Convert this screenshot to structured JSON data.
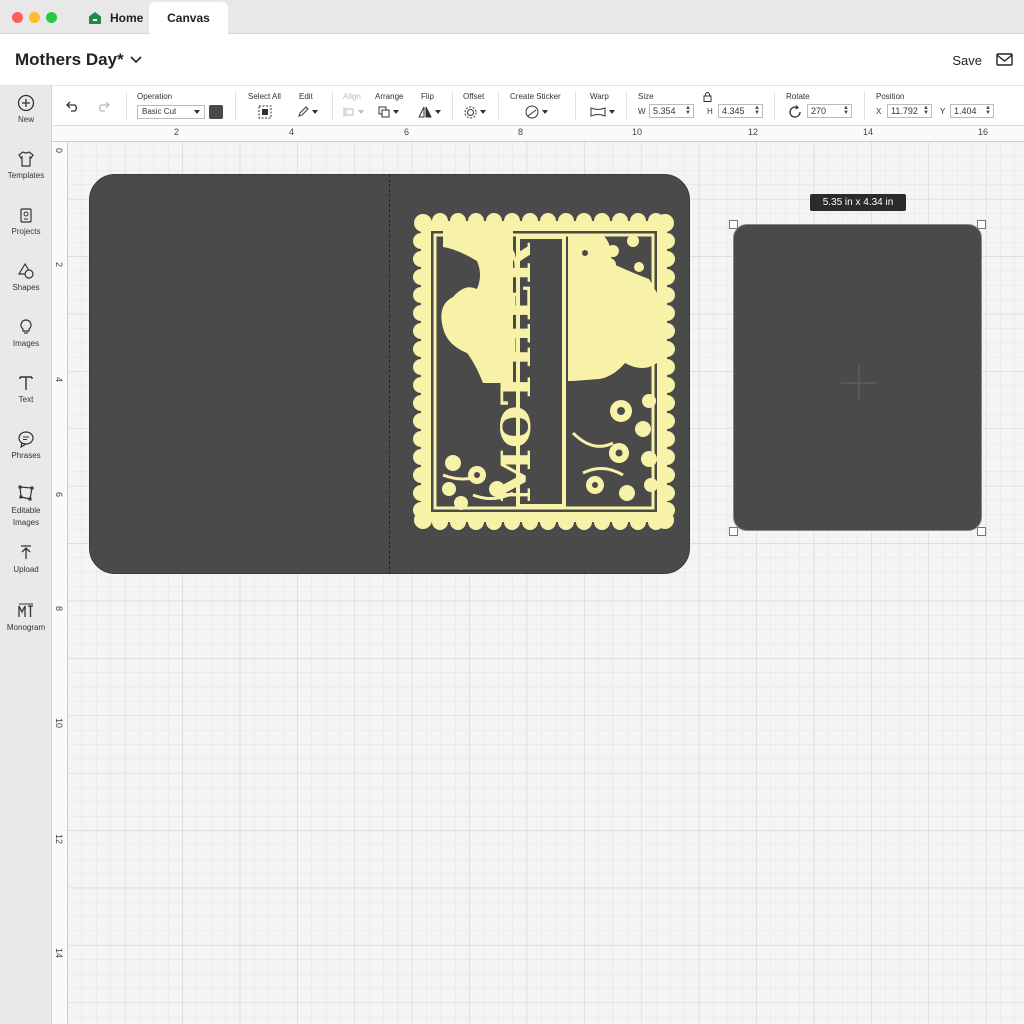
{
  "tabs": {
    "home": "Home",
    "canvas": "Canvas"
  },
  "header": {
    "project_title": "Mothers Day*",
    "save_label": "Save"
  },
  "toolbar": {
    "operation_label": "Operation",
    "operation_value": "Basic Cut",
    "select_all_label": "Select All",
    "edit_label": "Edit",
    "align_label": "Align",
    "arrange_label": "Arrange",
    "flip_label": "Flip",
    "offset_label": "Offset",
    "create_sticker_label": "Create Sticker",
    "warp_label": "Warp",
    "size_label": "Size",
    "w_label": "W",
    "w_value": "5.354",
    "h_label": "H",
    "h_value": "4.345",
    "rotate_label": "Rotate",
    "rotate_value": "270",
    "position_label": "Position",
    "x_label": "X",
    "x_value": "11.792",
    "y_label": "Y",
    "y_value": "1.404"
  },
  "sidebar": {
    "items": [
      {
        "label": "New",
        "icon": "plus-circle-icon"
      },
      {
        "label": "Templates",
        "icon": "shirt-icon"
      },
      {
        "label": "Projects",
        "icon": "projects-icon"
      },
      {
        "label": "Shapes",
        "icon": "shapes-icon"
      },
      {
        "label": "Images",
        "icon": "bulb-icon"
      },
      {
        "label": "Text",
        "icon": "text-icon"
      },
      {
        "label": "Phrases",
        "icon": "speech-bubble-icon"
      },
      {
        "label": "Editable Images",
        "icon": "editable-images-icon"
      },
      {
        "label": "Upload",
        "icon": "upload-icon"
      },
      {
        "label": "Monogram",
        "icon": "monogram-icon"
      }
    ]
  },
  "rulers": {
    "top": [
      "2",
      "4",
      "6",
      "8",
      "10",
      "12",
      "14",
      "16"
    ],
    "left": [
      "0",
      "2",
      "4",
      "6",
      "8",
      "10",
      "12",
      "14"
    ]
  },
  "canvas": {
    "dimension_tooltip": "5.35  in x 4.34  in",
    "design_text": "MOTHER"
  },
  "colors": {
    "card": "#4a4a4a",
    "design": "#f7f2a8",
    "accent": "#1f8a4c"
  }
}
